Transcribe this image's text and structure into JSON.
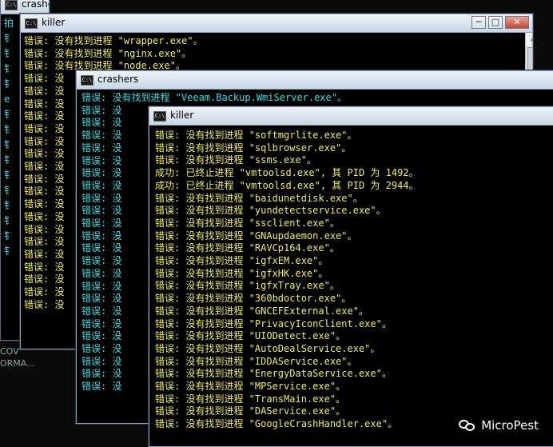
{
  "background_windows": {
    "crashers_back": {
      "title": "crashers",
      "side_text": [
        "拍",
        "钅",
        "钅",
        "钅",
        "钅",
        "e",
        "钅",
        "钅",
        "钅",
        "钅",
        "钅",
        "钅",
        "钅",
        "钅",
        "钅",
        "钅"
      ]
    },
    "left_fragment": [
      "COV",
      "ORMA..."
    ]
  },
  "killer_back": {
    "title": "killer",
    "lines": [
      "错误: 没有找到进程 \"wrapper.exe\"。",
      "错误: 没有找到进程 \"nginx.exe\"。",
      "错误: 没有找到进程 \"node.exe\"。",
      "错误: 没",
      "错误: 没",
      "错误: 没",
      "错误: 没",
      "错误: 没",
      "错误: 没",
      "错误: 没",
      "错误: 没",
      "错误: 没",
      "错误: 没",
      "错误: 没",
      "错误: 没",
      "错误: 没",
      "错误: 没",
      "错误: 没",
      "错误: 没",
      "错误: 没",
      "错误: 没",
      "错误: 没"
    ]
  },
  "crashers_mid": {
    "title": "crashers",
    "lines": [
      "错误: 没有找到进程 \"Veeam.Backup.WmiServer.exe\"。",
      "错误: 没",
      "错误: 没",
      "错误: 没",
      "错误: 没",
      "错误: 没",
      "错误: 没",
      "错误: 没",
      "错误: 没",
      "错误: 没",
      "错误: 没",
      "错误: 没",
      "错误: 没",
      "错误: 没",
      "错误: 没",
      "错误: 没",
      "错误: 没",
      "错误: 没",
      "错误: 没",
      "错误: 没",
      "错误: 没",
      "错误: 没",
      "错误: 没",
      "错误: 没"
    ]
  },
  "killer_front": {
    "title": "killer",
    "lines": [
      "错误: 没有找到进程 \"softmgrlite.exe\"。",
      "错误: 没有找到进程 \"sqlbrowser.exe\"。",
      "错误: 没有找到进程 \"ssms.exe\"。",
      "成功: 已终止进程 \"vmtoolsd.exe\", 其 PID 为 1492。",
      "成功: 已终止进程 \"vmtoolsd.exe\", 其 PID 为 2944。",
      "错误: 没有找到进程 \"baidunetdisk.exe\"。",
      "错误: 没有找到进程 \"yundetectservice.exe\"。",
      "错误: 没有找到进程 \"ssclient.exe\"。",
      "错误: 没有找到进程 \"GNAupdaemon.exe\"。",
      "错误: 没有找到进程 \"RAVCp164.exe\"。",
      "错误: 没有找到进程 \"igfxEM.exe\"。",
      "错误: 没有找到进程 \"igfxHK.exe\"。",
      "错误: 没有找到进程 \"igfxTray.exe\"。",
      "错误: 没有找到进程 \"360bdoctor.exe\"。",
      "错误: 没有找到进程 \"GNCEFExternal.exe\"。",
      "错误: 没有找到进程 \"PrivacyIconClient.exe\"。",
      "错误: 没有找到进程 \"UIODetect.exe\"。",
      "错误: 没有找到进程 \"AutoDealService.exe\"。",
      "错误: 没有找到进程 \"IDDAService.exe\"。",
      "错误: 没有找到进程 \"EnergyDataService.exe\"。",
      "错误: 没有找到进程 \"MPService.exe\"。",
      "错误: 没有找到进程 \"TransMain.exe\"。",
      "错误: 没有找到进程 \"DAService.exe\"。",
      "错误: 没有找到进程 \"GoogleCrashHandler.exe\"。"
    ]
  },
  "window_controls": {
    "minimize": "─",
    "maximize": "□",
    "close": "✕"
  },
  "watermark": {
    "text": "MicroPest",
    "icon": "wechat-icon"
  },
  "colors": {
    "yellow_text": "#f2ef50",
    "cyan_text": "#2fe0e6"
  }
}
